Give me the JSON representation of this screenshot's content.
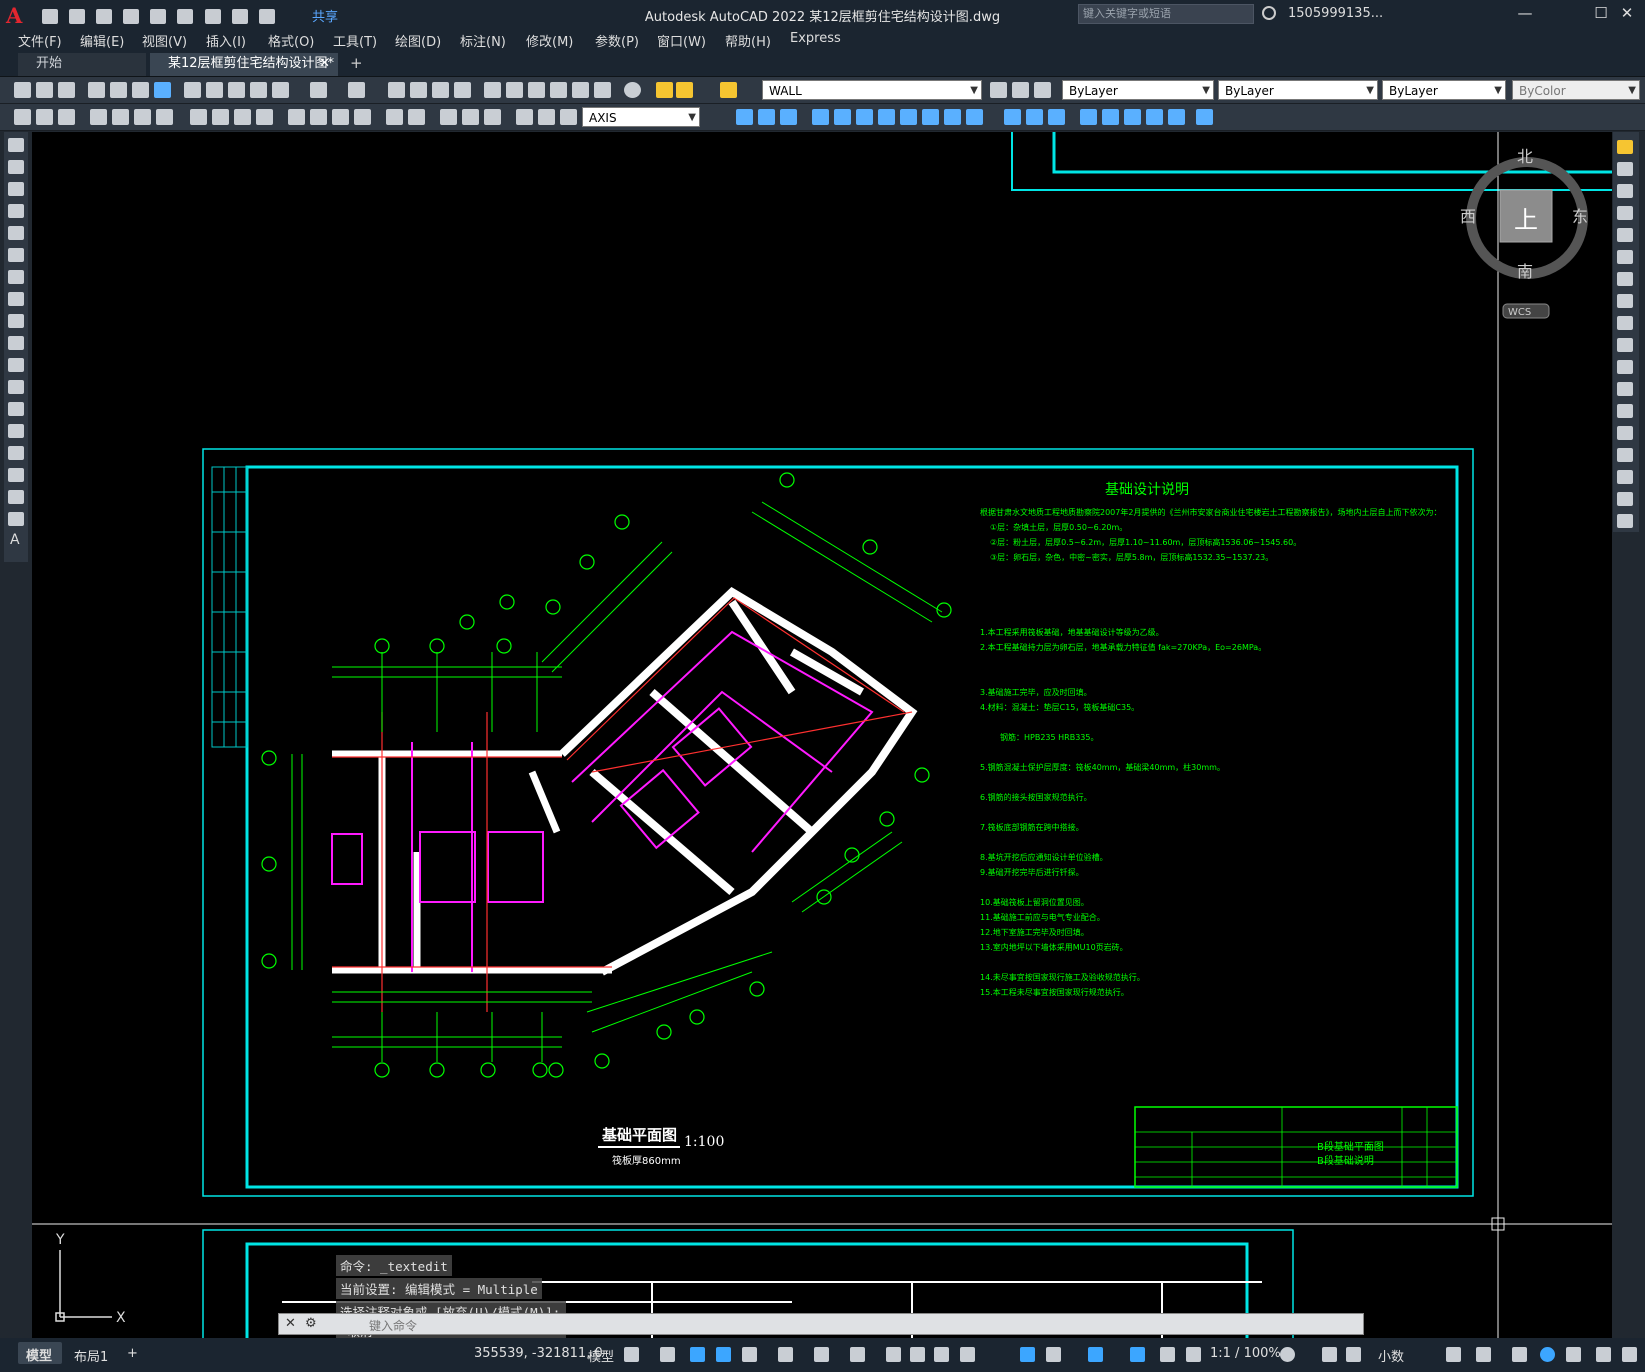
{
  "titlebar": {
    "app_title": "Autodesk AutoCAD 2022    某12层框剪住宅结构设计图.dwg",
    "share": "共享",
    "search_placeholder": "键入关键字或短语",
    "user": "1505999135...",
    "logo": "A"
  },
  "menu": [
    "文件(F)",
    "编辑(E)",
    "视图(V)",
    "插入(I)",
    "格式(O)",
    "工具(T)",
    "绘图(D)",
    "标注(N)",
    "修改(M)",
    "参数(P)",
    "窗口(W)",
    "帮助(H)",
    "Express"
  ],
  "tabs": {
    "start": "开始",
    "doc": "某12层框剪住宅结构设计图*"
  },
  "toolbar": {
    "layer": "WALL",
    "color": "ByLayer",
    "linetype": "ByLayer",
    "lineweight": "ByLayer",
    "plotstyle": "ByColor",
    "dimstyle": "AXIS"
  },
  "viewcube": {
    "north": "北",
    "south": "南",
    "east": "东",
    "west": "西",
    "face": "上",
    "wcs": "WCS"
  },
  "ucs": {
    "x": "X",
    "y": "Y"
  },
  "drawing": {
    "notes_title": "基础设计说明",
    "plan_title": "基础平面图",
    "plan_scale": "1:100",
    "plan_sub": "筏板厚860mm",
    "titleblock_a": "B段基础平面图",
    "titleblock_b": "B段基础说明",
    "notes": [
      "根据甘肃水文地质工程地质勘察院2007年2月提供的《兰州市安家台商业住宅楼岩土工程勘察报告》，场地内土层自上而下依次为：",
      "①层：杂填土层，层厚0.50~6.20m。",
      "②层：粉土层，层厚0.5~6.2m，层厚1.10~11.60m，层顶标高1536.06~1545.60。",
      "③层：卵石层，杂色，中密~密实，层厚5.8m，层顶标高1532.35~1537.23。",
      "1.本工程采用筏板基础，地基基础设计等级为乙级。",
      "2.本工程基础持力层为卵石层，地基承载力特征值 fak=270KPa，Eo=26MPa。",
      "3.基础施工完毕，应及时回填。",
      "4.材料：混凝土：垫层C15，筏板基础C35。",
      "钢筋：HPB235 HRB335。",
      "5.钢筋混凝土保护层厚度：筏板40mm，基础梁40mm，柱30mm。",
      "6.钢筋的接头按国家规范执行。",
      "7.筏板底部钢筋在跨中搭接。",
      "8.基坑开挖后应通知设计单位验槽。",
      "9.基础开挖完毕后进行钎探。",
      "10.基础筏板上留洞位置见图。",
      "11.基础施工前应与电气专业配合。",
      "12.地下室施工完毕及时回填。",
      "13.室内地坪以下墙体采用MU10页岩砖。",
      "14.未尽事宜按国家现行施工及验收规范执行。",
      "15.本工程未尽事宜按国家现行规范执行。"
    ]
  },
  "command": {
    "history": [
      "命令: _textedit",
      "当前设置: 编辑模式 = Multiple",
      "选择注释对象或 [放弃(U)/模式(M)]: *取消*"
    ],
    "placeholder": "键入命令"
  },
  "status": {
    "model_tab": "模型",
    "layout_tab": "布局1",
    "add_tab": "+",
    "coords": "355539, -321811, 0",
    "model": "模型",
    "scale": "1:1 / 100%",
    "units": "小数"
  }
}
